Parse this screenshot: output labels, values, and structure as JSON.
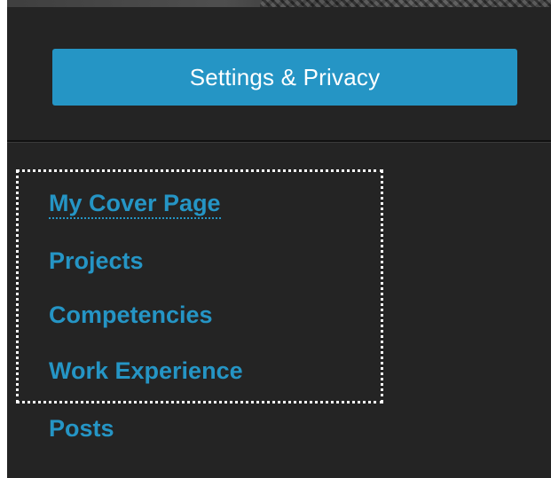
{
  "header": {
    "settings_label": "Settings & Privacy"
  },
  "nav": {
    "items": [
      {
        "label": "My Cover Page"
      },
      {
        "label": "Projects"
      },
      {
        "label": "Competencies"
      },
      {
        "label": "Work Experience"
      },
      {
        "label": "Posts"
      }
    ]
  },
  "colors": {
    "panel_background": "#242424",
    "accent": "#2595c5",
    "button_text": "#ffffff",
    "focus_outline": "#ffffff"
  }
}
